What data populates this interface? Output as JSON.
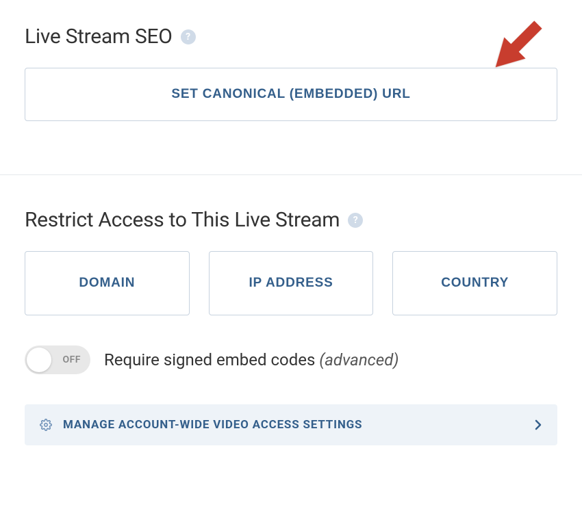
{
  "seo": {
    "title": "Live Stream SEO",
    "button_label": "SET CANONICAL (EMBEDDED) URL"
  },
  "restrict": {
    "title": "Restrict Access to This Live Stream",
    "buttons": [
      {
        "label": "DOMAIN"
      },
      {
        "label": "IP ADDRESS"
      },
      {
        "label": "COUNTRY"
      }
    ],
    "toggle": {
      "state_label": "OFF",
      "text": "Require signed embed codes ",
      "advanced": "(advanced)"
    },
    "manage_link": "MANAGE ACCOUNT-WIDE VIDEO ACCESS SETTINGS"
  }
}
